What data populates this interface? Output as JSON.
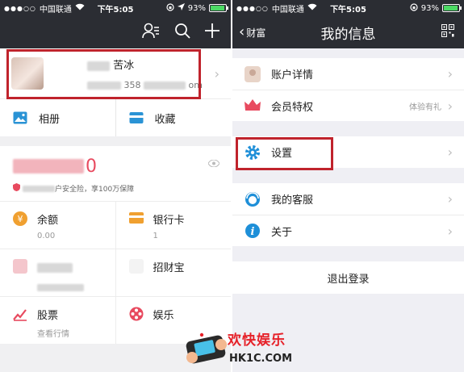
{
  "status_bar": {
    "left": {
      "signal": "●●●○○",
      "carrier": "中国联通"
    },
    "time": "下午5:05",
    "left_battery": "93%",
    "right": {
      "signal": "●●●○○",
      "carrier": "中国联通"
    },
    "right_battery": "93%"
  },
  "left_screen": {
    "profile": {
      "name_suffix": "苦冰",
      "phone_fragment": "358",
      "phone_end": "om"
    },
    "quick_actions": [
      {
        "label": "相册",
        "icon": "photo-album-icon"
      },
      {
        "label": "收藏",
        "icon": "favorites-icon"
      }
    ],
    "balance_card": {
      "amount_tail": "0",
      "insurance_text": "户安全险，享100万保障"
    },
    "tiles": [
      {
        "label": "余额",
        "sub": "0.00",
        "icon": "balance-coin-icon"
      },
      {
        "label": "银行卡",
        "sub": "1",
        "icon": "bank-card-icon"
      },
      {
        "label": "",
        "sub": "",
        "icon": "blurred-icon"
      },
      {
        "label": "招财宝",
        "sub": "",
        "icon": "zhaocaibao-icon"
      },
      {
        "label": "股票",
        "sub": "查看行情",
        "icon": "stock-chart-icon"
      },
      {
        "label": "娱乐",
        "sub": "",
        "icon": "film-reel-icon"
      }
    ]
  },
  "right_screen": {
    "back_label": "财富",
    "title": "我的信息",
    "groups": [
      [
        {
          "label": "账户详情",
          "sub": "",
          "icon": "account-avatar-icon"
        },
        {
          "label": "会员特权",
          "sub": "体验有礼",
          "icon": "crown-icon"
        }
      ],
      [
        {
          "label": "设置",
          "sub": "",
          "icon": "gear-icon"
        }
      ],
      [
        {
          "label": "我的客服",
          "sub": "",
          "icon": "customer-service-icon"
        },
        {
          "label": "关于",
          "sub": "",
          "icon": "info-icon"
        }
      ]
    ],
    "logout": "退出登录"
  },
  "watermark": {
    "title": "欢快娱乐",
    "url": "HK1C.COM"
  },
  "colors": {
    "nav_bar": "#2b2d33",
    "highlight_box": "#c0232c",
    "watermark_red": "#e62129"
  }
}
